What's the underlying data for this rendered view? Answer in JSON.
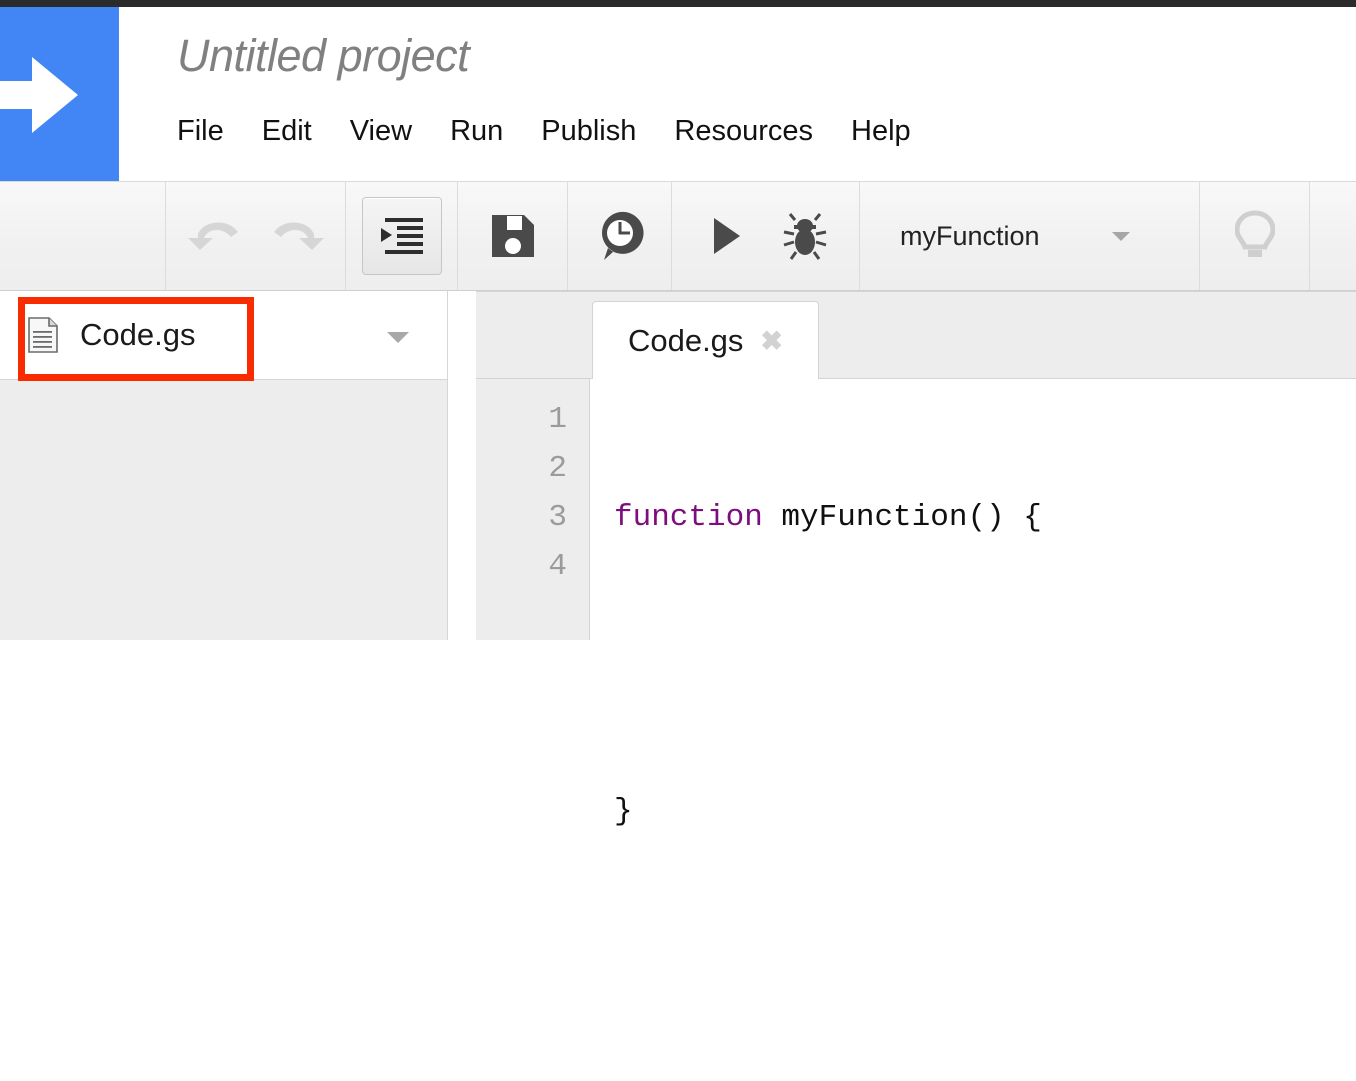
{
  "app": {
    "logo_icon": "right-arrow-logo-icon",
    "brand_color": "#4285f4",
    "title": "Untitled project"
  },
  "menubar": {
    "items": [
      {
        "label": "File"
      },
      {
        "label": "Edit"
      },
      {
        "label": "View"
      },
      {
        "label": "Run"
      },
      {
        "label": "Publish"
      },
      {
        "label": "Resources"
      },
      {
        "label": "Help"
      }
    ]
  },
  "toolbar": {
    "undo": {
      "icon": "undo-icon",
      "enabled": false
    },
    "redo": {
      "icon": "redo-icon",
      "enabled": false
    },
    "indent": {
      "icon": "indent-icon",
      "pressed": true
    },
    "save": {
      "icon": "save-floppy-icon"
    },
    "history": {
      "icon": "clock-history-icon"
    },
    "run": {
      "icon": "play-icon"
    },
    "debug": {
      "icon": "bug-icon"
    },
    "function_select": {
      "value": "myFunction",
      "caret_icon": "chevron-down-icon"
    },
    "hint": {
      "icon": "lightbulb-icon",
      "enabled": false
    }
  },
  "sidebar": {
    "files": [
      {
        "name": "Code.gs",
        "icon": "document-file-icon",
        "selected": true
      }
    ],
    "caret_icon": "caret-down-icon"
  },
  "annotation": {
    "type": "highlight-rectangle",
    "color": "#f92c00",
    "target": "Code.gs"
  },
  "editor": {
    "tabs": [
      {
        "label": "Code.gs",
        "active": true,
        "close_icon": "close-x-icon",
        "close_glyph": "✖"
      }
    ],
    "gutter": [
      "1",
      "2",
      "3",
      "4"
    ],
    "keyword_color": "#7d0e7d",
    "code": {
      "line1_keyword": "function",
      "line1_rest": " myFunction() {",
      "line2": "",
      "line3": "}",
      "line4": ""
    }
  }
}
